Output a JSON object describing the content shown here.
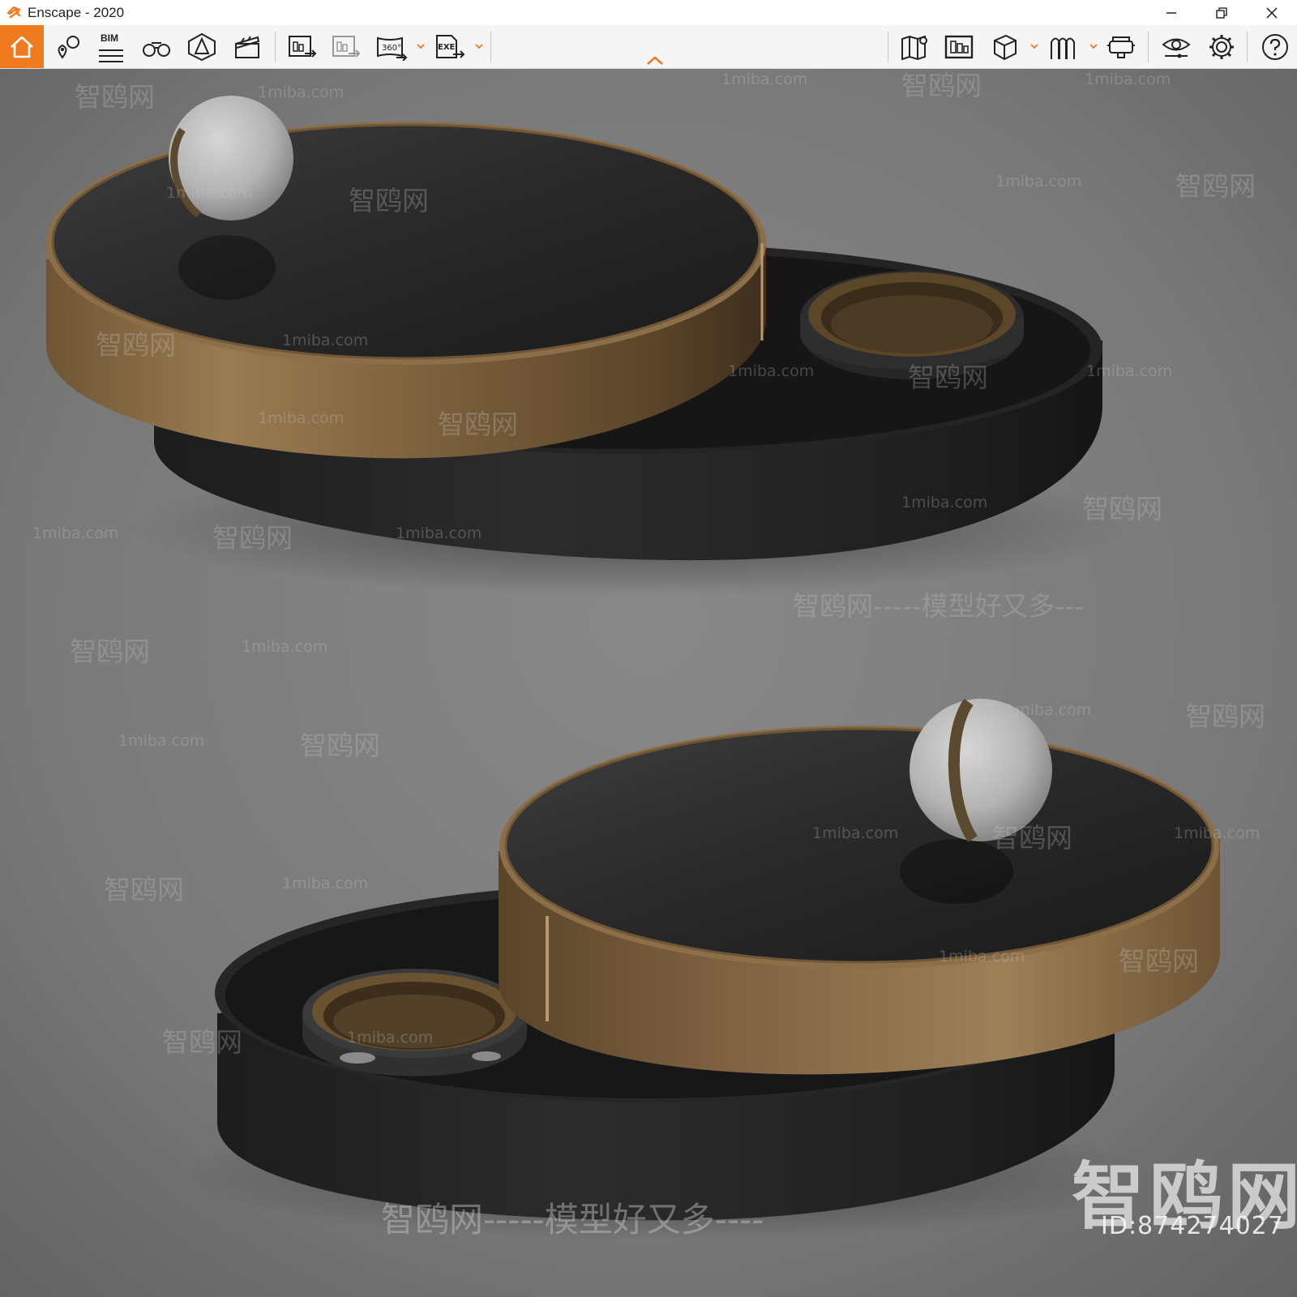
{
  "window": {
    "title": "Enscape - 2020"
  },
  "toolbar": {
    "bim_label": "BIM",
    "icons_left": [
      "home-icon",
      "map-pin-icon",
      "bim-list-icon",
      "binoculars-icon",
      "perspective-icon",
      "clapper-icon",
      "export-image-icon",
      "batch-export-icon",
      "panorama-360-icon",
      "export-exe-icon"
    ],
    "icons_right": [
      "map-icon",
      "asset-library-icon",
      "cube-icon",
      "arch-view-icon",
      "vr-headset-icon",
      "eye-settings-icon",
      "gear-icon",
      "help-icon"
    ],
    "accent_color": "#f07a1f"
  },
  "watermarks": {
    "site": "1miba.com",
    "brand": "智鸥网",
    "slogan": "智鸥网-----模型好又多----",
    "slogan_short": "智鸥网-----模型好又多---",
    "id": "ID:874274027"
  }
}
